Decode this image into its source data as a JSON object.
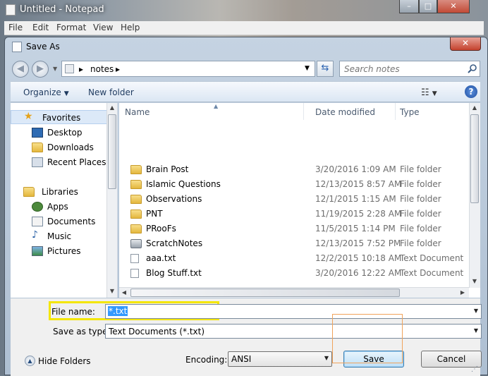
{
  "notepad": {
    "title": "Untitled - Notepad",
    "menu": [
      "File",
      "Edit",
      "Format",
      "View",
      "Help"
    ],
    "window_buttons": [
      "–",
      "□",
      "✕"
    ]
  },
  "dialog": {
    "title": "Save As",
    "close_glyph": "✕"
  },
  "address": {
    "back_glyph": "◀",
    "forward_glyph": "▶",
    "crumb_sep": "▸",
    "path": "notes",
    "refresh_glyph": "⇆",
    "search_placeholder": "Search notes"
  },
  "toolbar": {
    "organize": "Organize",
    "new_folder": "New folder",
    "help": "?"
  },
  "nav": {
    "favorites": {
      "label": "Favorites",
      "items": [
        "Desktop",
        "Downloads",
        "Recent Places"
      ]
    },
    "libraries": {
      "label": "Libraries",
      "items": [
        "Apps",
        "Documents",
        "Music",
        "Pictures"
      ]
    }
  },
  "files": {
    "columns": [
      "Name",
      "Date modified",
      "Type"
    ],
    "rows": [
      {
        "name": "Brain Post",
        "date": "3/20/2016 1:09 AM",
        "type": "File folder",
        "icon": "folder-icon"
      },
      {
        "name": "Islamic Questions",
        "date": "12/13/2015 8:57 AM",
        "type": "File folder",
        "icon": "folder-icon"
      },
      {
        "name": "Observations",
        "date": "12/1/2015 1:15 AM",
        "type": "File folder",
        "icon": "folder-icon"
      },
      {
        "name": "PNT",
        "date": "11/19/2015 2:28 AM",
        "type": "File folder",
        "icon": "folder-icon"
      },
      {
        "name": "PRooFs",
        "date": "11/5/2015 1:14 PM",
        "type": "File folder",
        "icon": "folder-icon"
      },
      {
        "name": "ScratchNotes",
        "date": "12/13/2015 7:52 PM",
        "type": "File folder",
        "icon": "hdd-folder-icon"
      },
      {
        "name": "aaa.txt",
        "date": "12/2/2015 10:18 AM",
        "type": "Text Document",
        "icon": "text-file-icon"
      },
      {
        "name": "Blog Stuff.txt",
        "date": "3/20/2016 12:22 AM",
        "type": "Text Document",
        "icon": "text-file-icon"
      }
    ]
  },
  "form": {
    "file_name_label": "File name:",
    "file_name_value": "*.txt",
    "save_type_label": "Save as type:",
    "save_type_value": "Text Documents (*.txt)"
  },
  "footer": {
    "hide_folders": "Hide Folders",
    "encoding_label": "Encoding:",
    "encoding_value": "ANSI",
    "save": "Save",
    "cancel": "Cancel"
  },
  "colors": {
    "selection": "#3399ff",
    "highlight_box": "#f4e600",
    "save_focus_box": "#f0a35b"
  }
}
